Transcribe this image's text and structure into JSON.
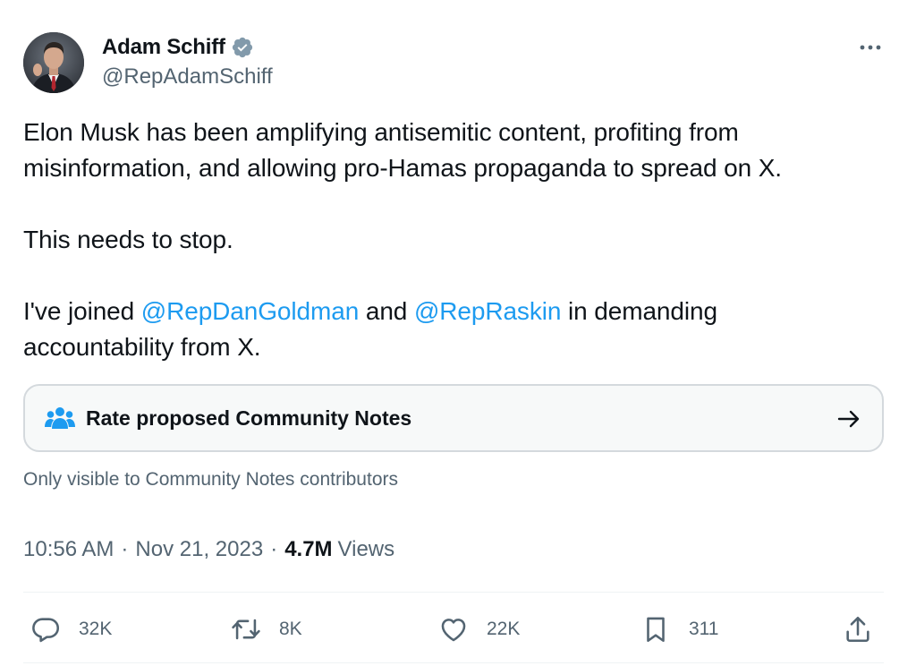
{
  "author": {
    "display_name": "Adam Schiff",
    "handle": "@RepAdamSchiff",
    "verified_icon": "verified-badge-icon"
  },
  "tweet": {
    "line1": "Elon Musk has been amplifying antisemitic content, profiting from",
    "line2": "misinformation, and allowing pro-Hamas propaganda to spread on X.",
    "line3": "This needs to stop.",
    "line4_prefix": "I've joined ",
    "mention1": "@RepDanGoldman",
    "line4_mid": " and ",
    "mention2": "@RepRaskin",
    "line4_suffix": " in demanding",
    "line5": "accountability from X."
  },
  "community_notes": {
    "label": "Rate proposed Community Notes",
    "subtext": "Only visible to Community Notes contributors"
  },
  "meta": {
    "time": "10:56 AM",
    "separator": "·",
    "date": "Nov 21, 2023",
    "views_count": "4.7M",
    "views_label": "Views"
  },
  "actions": {
    "replies": "32K",
    "reposts": "8K",
    "likes": "22K",
    "bookmarks": "311"
  },
  "colors": {
    "link": "#1d9bf0",
    "secondary_text": "#536471",
    "primary_text": "#0f1419",
    "card_bg": "#f7f9f9",
    "card_border": "#d4d9dd"
  }
}
